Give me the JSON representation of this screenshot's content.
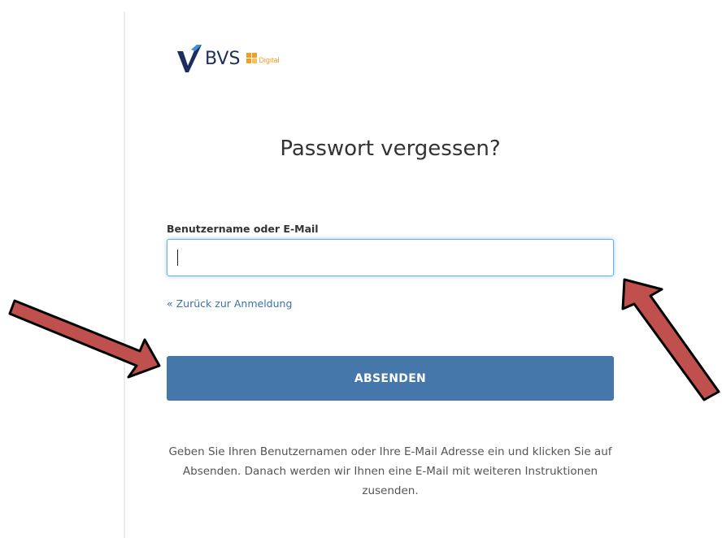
{
  "logo": {
    "brand_text": "BVS",
    "sub_text": "Digital",
    "accent_color": "#f0a020",
    "brand_color": "#1c2f5c"
  },
  "page": {
    "title": "Passwort vergessen?"
  },
  "form": {
    "field_label": "Benutzername oder E-Mail",
    "field_value": "",
    "field_placeholder": "",
    "back_link_text": "« Zurück zur Anmeldung",
    "submit_label": "ABSENDEN"
  },
  "info": {
    "text": "Geben Sie Ihren Benutzernamen oder Ihre E-Mail Adresse ein und klicken Sie auf Absenden. Danach werden wir Ihnen eine E-Mail mit weiteren Instruktionen zusenden."
  },
  "annotations": {
    "arrow_color": "#c0504d",
    "arrow_icon": "pointer-arrow-icon"
  },
  "colors": {
    "primary_button": "#4677aa",
    "link": "#3a72a8",
    "input_focus": "#66afe9"
  }
}
